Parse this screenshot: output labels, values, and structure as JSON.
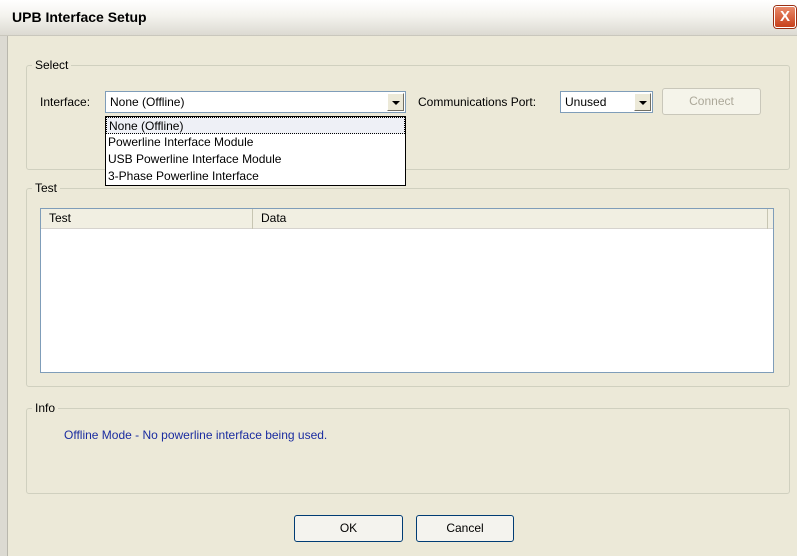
{
  "window": {
    "title": "UPB Interface Setup",
    "close_glyph": "X"
  },
  "select_group": {
    "legend": "Select",
    "interface_label": "Interface:",
    "interface_value": "None (Offline)",
    "interface_options": [
      "None (Offline)",
      "Powerline Interface Module",
      "USB Powerline Interface Module",
      "3-Phase Powerline Interface"
    ],
    "port_label": "Communications Port:",
    "port_value": "Unused",
    "connect_label": "Connect"
  },
  "test_group": {
    "legend": "Test",
    "columns": [
      "Test",
      "Data"
    ],
    "rows": []
  },
  "info_group": {
    "legend": "Info",
    "message": "Offline Mode - No powerline interface being used."
  },
  "buttons": {
    "ok": "OK",
    "cancel": "Cancel"
  },
  "colors": {
    "info_text": "#1a2ca0",
    "close_button": "#c7401b"
  }
}
